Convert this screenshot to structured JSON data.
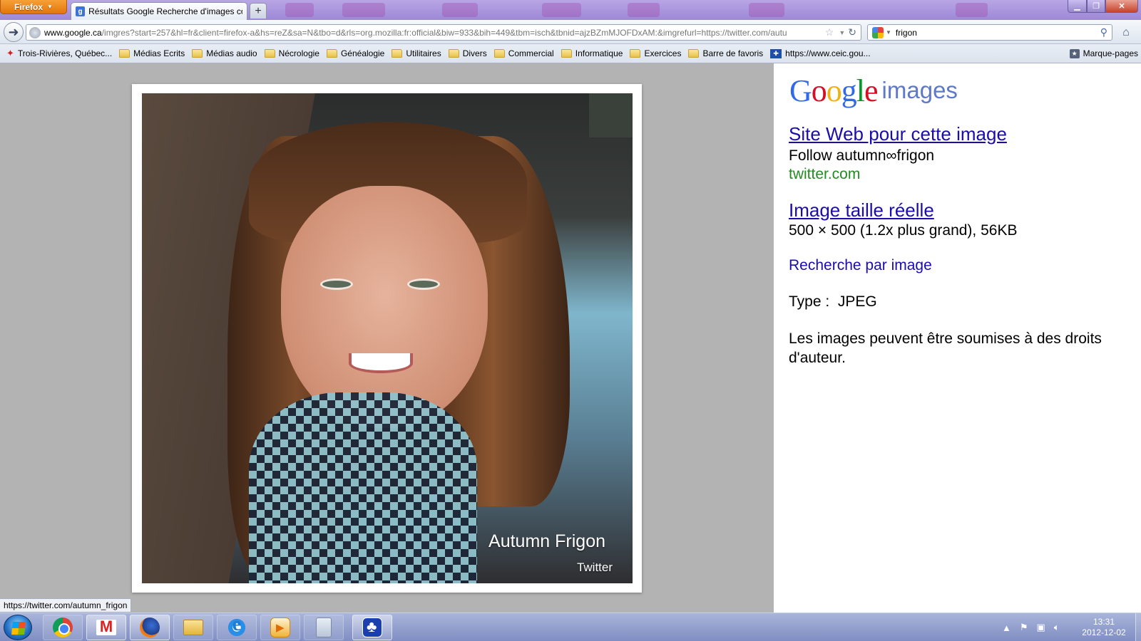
{
  "browser": {
    "app_button": "Firefox",
    "tab_title": "Résultats Google Recherche d'images co...",
    "new_tab": "+",
    "url_host": "www.google.ca",
    "url_path": "/imgres?start=257&hl=fr&client=firefox-a&hs=reZ&sa=N&tbo=d&rls=org.mozilla:fr:official&biw=933&bih=449&tbm=isch&tbnid=ajzBZmMJOFDxAM:&imgrefurl=https://twitter.com/autu",
    "search_query": "frigon",
    "status_url": "https://twitter.com/autumn_frigon"
  },
  "bookmarks": {
    "items": [
      {
        "label": "Trois-Rivières, Québec...",
        "icon": "maple-leaf-icon"
      },
      {
        "label": "Médias Ecrits",
        "icon": "folder-icon"
      },
      {
        "label": "Médias audio",
        "icon": "folder-icon"
      },
      {
        "label": "Nécrologie",
        "icon": "folder-icon"
      },
      {
        "label": "Généalogie",
        "icon": "folder-icon"
      },
      {
        "label": "Utilitaires",
        "icon": "folder-icon"
      },
      {
        "label": "Divers",
        "icon": "folder-icon"
      },
      {
        "label": "Commercial",
        "icon": "folder-icon"
      },
      {
        "label": "Informatique",
        "icon": "folder-icon"
      },
      {
        "label": "Exercices",
        "icon": "folder-icon"
      },
      {
        "label": "Barre de favoris",
        "icon": "folder-icon"
      },
      {
        "label": "https://www.ceic.gou...",
        "icon": "quebec-flag-icon"
      }
    ],
    "marque_pages": "Marque-pages"
  },
  "image": {
    "caption": "Autumn Frigon",
    "source": "Twitter"
  },
  "panel": {
    "logo_brand": "Google",
    "logo_suffix": "images",
    "site_link": "Site Web pour cette image",
    "site_title": "Follow autumn∞frigon",
    "site_domain": "twitter.com",
    "fullsize_link": "Image taille réelle",
    "fullsize_details": "500 × 500 (1.2x plus grand), 56KB",
    "search_by_image": "Recherche par image",
    "type_line": "Type :  JPEG",
    "rights": "Les images peuvent être soumises à des droits d'auteur."
  },
  "taskbar": {
    "apps": [
      "chrome-icon",
      "gmail-icon",
      "firefox-icon",
      "explorer-icon",
      "ie-icon",
      "media-player-icon",
      "calculator-icon",
      "app-icon"
    ],
    "time": "13:31",
    "date": "2012-12-02"
  },
  "colors": {
    "link": "#1a0dab",
    "domain_green": "#228b22",
    "firefox_orange": "#e1760d",
    "titlebar_purple": "#9d88d6"
  }
}
